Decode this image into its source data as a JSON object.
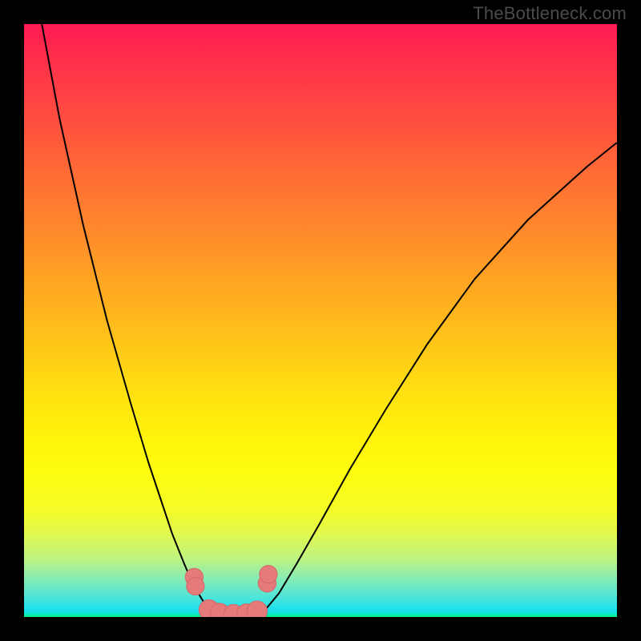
{
  "watermark": "TheBottleneck.com",
  "colors": {
    "curve": "#000000",
    "markers_fill": "#e47a7a",
    "markers_stroke": "#d46a6a",
    "frame_bg": "#000000"
  },
  "chart_data": {
    "type": "line",
    "title": "",
    "xlabel": "",
    "ylabel": "",
    "xlim": [
      0,
      100
    ],
    "ylim": [
      0,
      100
    ],
    "series": [
      {
        "name": "curve-left",
        "x": [
          3,
          6,
          10,
          14,
          18,
          21,
          23,
          25,
          27,
          28.5,
          30,
          31
        ],
        "y": [
          100,
          84,
          66,
          50,
          36,
          26,
          20,
          14,
          9,
          5.5,
          3,
          1.5
        ]
      },
      {
        "name": "curve-valley",
        "x": [
          31,
          32.5,
          34.5,
          37,
          39.5,
          41
        ],
        "y": [
          1.5,
          0.7,
          0.5,
          0.5,
          0.8,
          1.6
        ]
      },
      {
        "name": "curve-right",
        "x": [
          41,
          43,
          46,
          50,
          55,
          61,
          68,
          76,
          85,
          95,
          100
        ],
        "y": [
          1.6,
          4,
          9,
          16,
          25,
          35,
          46,
          57,
          67,
          76,
          80
        ]
      }
    ],
    "markers": {
      "name": "valley-markers",
      "x": [
        28.7,
        28.9,
        31.2,
        33.0,
        35.3,
        37.5,
        39.3,
        41.0,
        41.2
      ],
      "y": [
        6.7,
        5.2,
        1.2,
        0.7,
        0.5,
        0.6,
        1.0,
        5.7,
        7.2
      ],
      "r": [
        1.5,
        1.5,
        1.7,
        1.6,
        1.6,
        1.6,
        1.7,
        1.5,
        1.5
      ]
    }
  }
}
